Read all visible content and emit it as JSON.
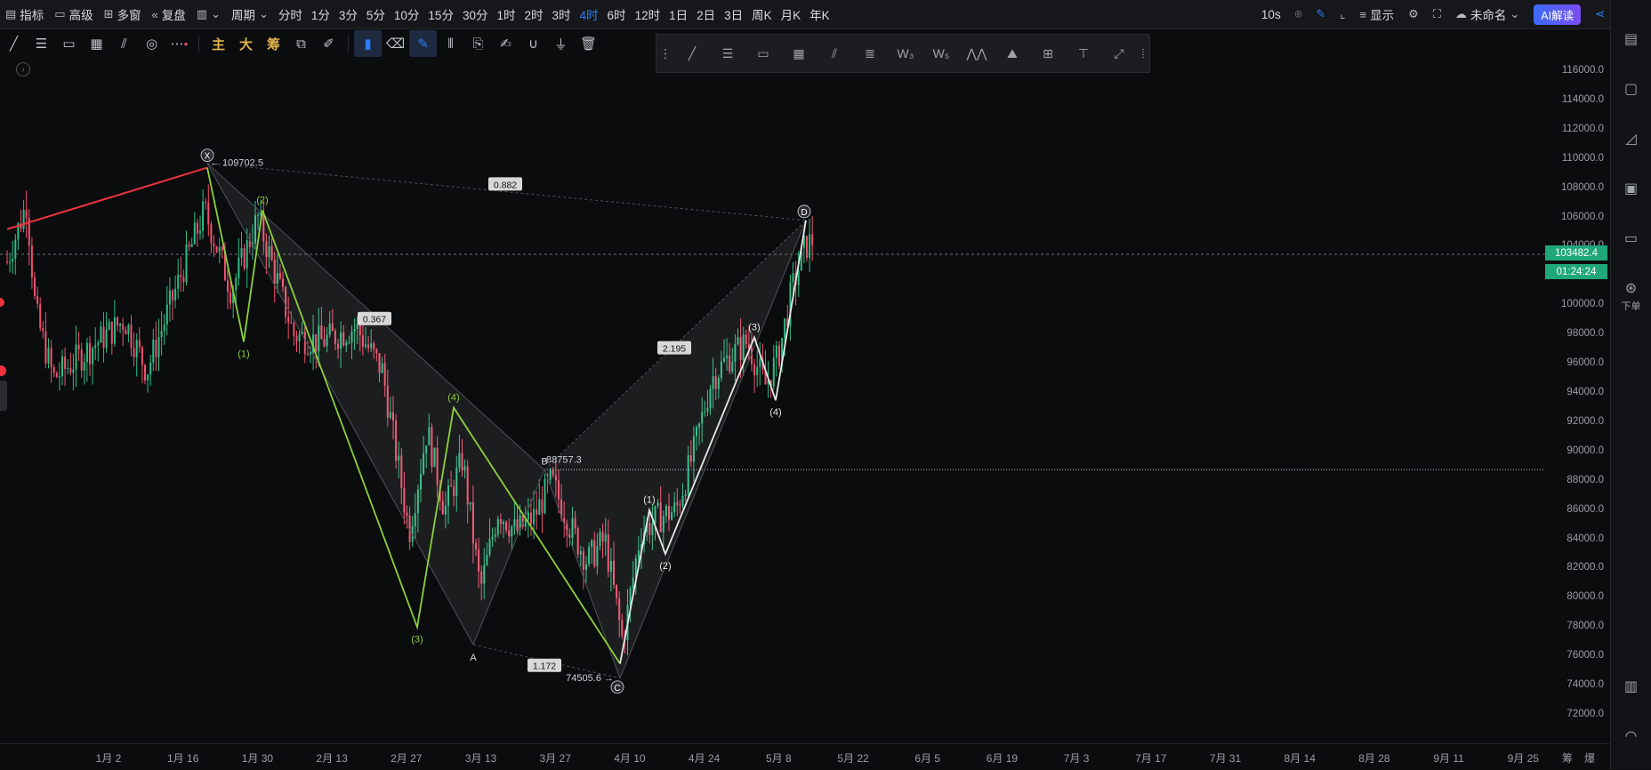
{
  "topbar": {
    "left_items": [
      {
        "icon": "indicator-icon",
        "label": "指标"
      },
      {
        "icon": "folder-icon",
        "label": "高级"
      },
      {
        "icon": "grid-icon",
        "label": "多窗"
      },
      {
        "icon": "rewind-icon",
        "label": "复盘"
      }
    ],
    "chart_type_icon": "candlestick-icon",
    "period_label": "周期",
    "periods": [
      "分时",
      "1分",
      "3分",
      "5分",
      "10分",
      "15分",
      "30分",
      "1时",
      "2时",
      "3时",
      "4时",
      "6时",
      "12时",
      "1日",
      "2日",
      "3日",
      "周K",
      "月K",
      "年K"
    ],
    "active_period": "4时",
    "refresh_label": "10s",
    "display_label": "显示",
    "layout_name": "未命名",
    "ai_label": "AI解读"
  },
  "drawing_toolbar": {
    "tools": [
      "line-tool-icon",
      "horizontal-line-icon",
      "rectangle-icon",
      "ruler-icon",
      "parallel-channel-icon",
      "spiral-icon",
      "more-icon"
    ],
    "text_tools": [
      "主",
      "大",
      "筹"
    ],
    "extra_tools": [
      "snapshot-icon",
      "pencil-line-icon",
      "bookmark-icon",
      "eraser-icon",
      "pen-icon",
      "bars-icon",
      "copy-icon",
      "edit-icon",
      "magnet-icon",
      "filter-icon",
      "trash-icon"
    ]
  },
  "draw_panel": {
    "tools": [
      "drag-handle-icon",
      "segment-icon",
      "hline-icon",
      "rect-icon",
      "fib-icon",
      "fan-icon",
      "gann-icon",
      "wave-icon",
      "wave5-icon",
      "triangle-icon",
      "abcd-icon",
      "frame-icon",
      "price-range-icon",
      "arrow-line-icon"
    ]
  },
  "right_sidebar": {
    "items": [
      {
        "icon": "list-icon",
        "label": ""
      },
      {
        "icon": "doc-icon",
        "label": ""
      },
      {
        "icon": "depth-icon",
        "label": ""
      },
      {
        "icon": "chart-icon",
        "label": ""
      },
      {
        "icon": "wallet-icon",
        "label": ""
      },
      {
        "icon": "order-icon",
        "label": "下单"
      },
      {
        "icon": "layout-icon",
        "label": ""
      },
      {
        "icon": "headset-icon",
        "label": ""
      }
    ]
  },
  "price_axis": {
    "ticks": [
      "116000.0",
      "114000.0",
      "112000.0",
      "110000.0",
      "108000.0",
      "106000.0",
      "104000.0",
      "100000.0",
      "98000.0",
      "96000.0",
      "94000.0",
      "92000.0",
      "90000.0",
      "88000.0",
      "86000.0",
      "84000.0",
      "82000.0",
      "80000.0",
      "78000.0",
      "76000.0",
      "74000.0",
      "72000.0"
    ],
    "current_price": "103482.4",
    "countdown": "01:24:24",
    "current_color": "#1fa77a"
  },
  "time_axis": {
    "ticks": [
      "1月 2",
      "1月 16",
      "1月 30",
      "2月 13",
      "2月 27",
      "3月 13",
      "3月 27",
      "4月 10",
      "4月 24",
      "5月 8",
      "5月 22",
      "6月 5",
      "6月 19",
      "7月 3",
      "7月 17",
      "7月 31",
      "8月 14",
      "8月 28",
      "9月 11",
      "9月 25"
    ],
    "right_labels": [
      "筹",
      "爆"
    ]
  },
  "chart_data": {
    "type": "candlestick",
    "title": "",
    "ylim": [
      71000,
      117000
    ],
    "pattern": {
      "points": [
        {
          "label": "X",
          "price": 109702.5
        },
        {
          "label": "A",
          "price": 76800
        },
        {
          "label": "B",
          "price": 88757.3
        },
        {
          "label": "C",
          "price": 74505.6
        },
        {
          "label": "D",
          "price": 105800
        }
      ],
      "ratios": [
        {
          "label": "0.882"
        },
        {
          "label": "0.367"
        },
        {
          "label": "1.172"
        },
        {
          "label": "2.195"
        }
      ],
      "price_labels": [
        "109702.5",
        "88757.3",
        "74505.6"
      ]
    },
    "wave_labels_green": [
      "(1)",
      "(2)",
      "(3)",
      "(4)"
    ],
    "wave_labels_white": [
      "(1)",
      "(2)",
      "(3)",
      "(4)"
    ],
    "colors": {
      "up": "#2ebd85",
      "down": "#f0516d",
      "wave_green": "#8cd13a",
      "wave_white": "#e8e8e8",
      "trend_red": "#f0323f"
    }
  }
}
